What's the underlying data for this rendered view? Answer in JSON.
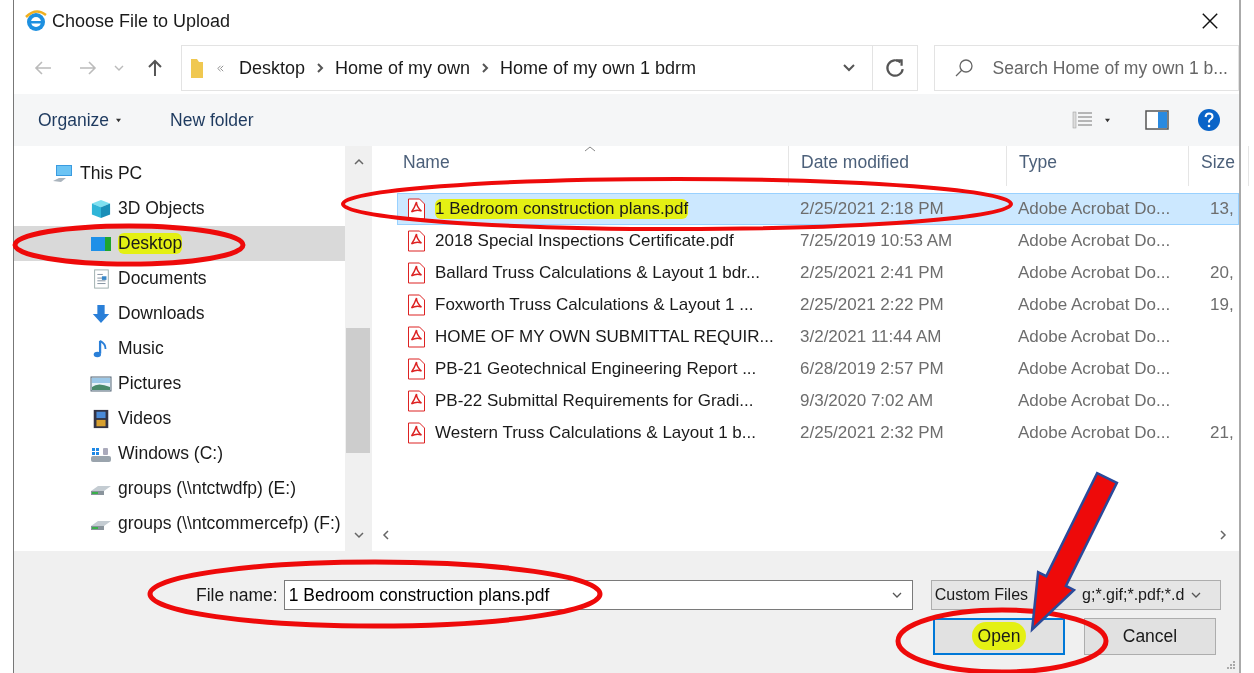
{
  "window": {
    "title": "Choose File to Upload"
  },
  "address": {
    "breadcrumb": [
      "Desktop",
      "Home of my own",
      "Home of my own 1 bdrm"
    ]
  },
  "search": {
    "placeholder": "Search Home of my own 1 b..."
  },
  "toolbar": [
    {
      "label": "Organize",
      "kind": "menu"
    },
    {
      "label": "New folder",
      "kind": "button"
    }
  ],
  "nav": [
    {
      "label": "This PC",
      "kind": "computer",
      "selected": false,
      "highlighted": false,
      "children": [
        {
          "label": "3D Objects",
          "kind": "cube",
          "selected": false,
          "highlighted": false
        },
        {
          "label": "Desktop",
          "kind": "desktop",
          "selected": true,
          "highlighted": true
        },
        {
          "label": "Documents",
          "kind": "document",
          "selected": false,
          "highlighted": false
        },
        {
          "label": "Downloads",
          "kind": "download",
          "selected": false,
          "highlighted": false
        },
        {
          "label": "Music",
          "kind": "music",
          "selected": false,
          "highlighted": false
        },
        {
          "label": "Pictures",
          "kind": "picture",
          "selected": false,
          "highlighted": false
        },
        {
          "label": "Videos",
          "kind": "video",
          "selected": false,
          "highlighted": false
        },
        {
          "label": "Windows (C:)",
          "kind": "drive",
          "selected": false,
          "highlighted": false
        },
        {
          "label": "groups (\\\\ntctwdfp) (E:)",
          "kind": "network-drive",
          "selected": false,
          "highlighted": false
        },
        {
          "label": "groups (\\\\ntcommercefp) (F:)",
          "kind": "network-drive",
          "selected": false,
          "highlighted": false
        }
      ]
    }
  ],
  "table": {
    "columns": [
      "Name",
      "Date modified",
      "Type",
      "Size"
    ],
    "rows": [
      {
        "name": "1 Bedroom construction plans.pdf",
        "date": "2/25/2021 2:18 PM",
        "type": "Adobe Acrobat Do...",
        "size": "13,",
        "selected": true,
        "highlighted": true
      },
      {
        "name": "2018 Special Inspections Certificate.pdf",
        "date": "7/25/2019 10:53 AM",
        "type": "Adobe Acrobat Do...",
        "selected": false,
        "highlighted": false
      },
      {
        "name": "Ballard Truss Calculations & Layout 1 bdr...",
        "date": "2/25/2021 2:41 PM",
        "type": "Adobe Acrobat Do...",
        "size": "20,",
        "selected": false,
        "highlighted": false
      },
      {
        "name": "Foxworth Truss Calculations & Layout 1 ...",
        "date": "2/25/2021 2:22 PM",
        "type": "Adobe Acrobat Do...",
        "size": "19,",
        "selected": false,
        "highlighted": false
      },
      {
        "name": "HOME OF MY OWN SUBMITTAL REQUIR...",
        "date": "3/2/2021 11:44 AM",
        "type": "Adobe Acrobat Do...",
        "selected": false,
        "highlighted": false
      },
      {
        "name": "PB-21 Geotechnical Engineering Report ...",
        "date": "6/28/2019 2:57 PM",
        "type": "Adobe Acrobat Do...",
        "selected": false,
        "highlighted": false
      },
      {
        "name": "PB-22 Submittal Requirements for Gradi...",
        "date": "9/3/2020 7:02 AM",
        "type": "Adobe Acrobat Do...",
        "selected": false,
        "highlighted": false
      },
      {
        "name": "Western Truss Calculations & Layout 1 b...",
        "date": "2/25/2021 2:32 PM",
        "type": "Adobe Acrobat Do...",
        "size": "21,",
        "selected": false,
        "highlighted": false
      }
    ]
  },
  "file_name": {
    "label": "File name:",
    "value": "1 Bedroom construction plans.pdf"
  },
  "filter": {
    "visible_parts": [
      "Custom Files",
      "g;*.gif;*.pdf;*.d"
    ]
  },
  "buttons": [
    {
      "label": "Open",
      "default": true,
      "highlighted": true
    },
    {
      "label": "Cancel",
      "default": false,
      "highlighted": false
    }
  ]
}
